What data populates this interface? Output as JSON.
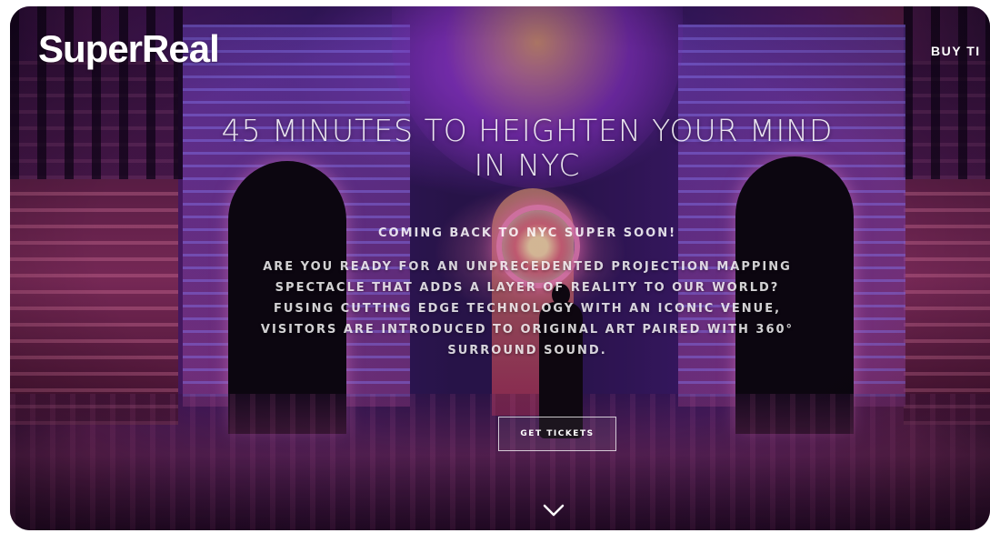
{
  "header": {
    "logo_text": "SuperReal",
    "buy_link_label": "BUY TI"
  },
  "hero": {
    "title_line1": "45 MINUTES TO HEIGHTEN YOUR MIND",
    "title_line2": "IN NYC",
    "subtitle": "COMING BACK TO NYC SUPER SOON!",
    "body": "ARE YOU READY FOR AN UNPRECEDENTED PROJECTION MAPPING SPECTACLE THAT ADDS A LAYER OF REALITY TO OUR WORLD? FUSING CUTTING EDGE TECHNOLOGY WITH AN ICONIC VENUE, VISITORS ARE INTRODUCED TO ORIGINAL ART PAIRED WITH 360° SURROUND SOUND.",
    "cta_label": "GET TICKETS"
  },
  "icons": {
    "scroll": "chevron-down-icon"
  },
  "colors": {
    "text": "#ffffff",
    "accent_purple": "#6a2fb0",
    "accent_pink": "#ff6fb8"
  }
}
